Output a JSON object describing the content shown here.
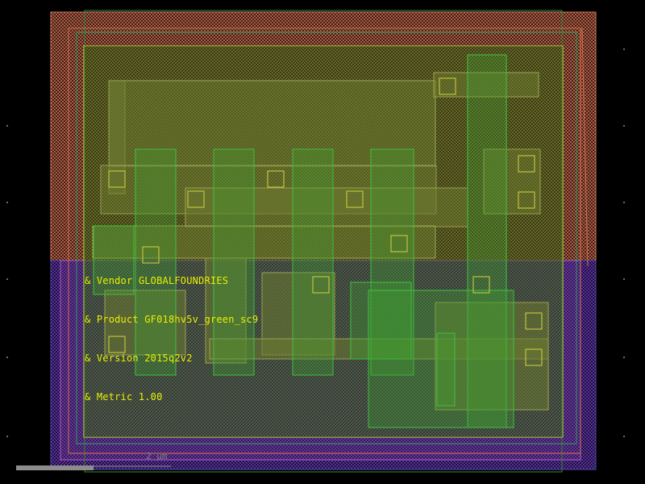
{
  "annotations": {
    "vendor": "& Vendor GLOBALFOUNDRIES",
    "product": "& Product GF018hv5v_green_sc9",
    "version": "& Version 2015q2v2",
    "metric": "& Metric 1.00"
  },
  "scale": {
    "label": "2 µm"
  },
  "layers": {
    "pwell": "#d8775f",
    "nwell": "#4a4aa8",
    "comp": "#40c040",
    "poly": "#c8e040",
    "metal1": "#7a8040",
    "contact": "#c0c040"
  }
}
